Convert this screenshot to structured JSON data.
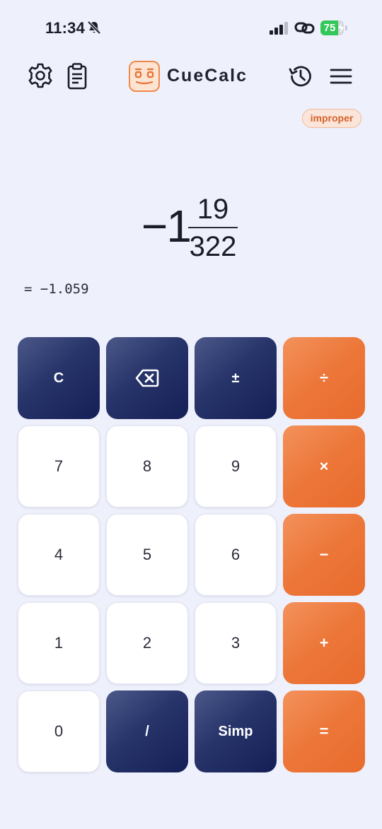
{
  "status_bar": {
    "time": "11:34",
    "battery": "75",
    "battery_level": 0.75
  },
  "header": {
    "app_title": "CueCalc",
    "icons": [
      "gear-icon",
      "clipboard-icon",
      "app-logo",
      "history-icon",
      "menu-icon"
    ]
  },
  "mode_badge": "improper",
  "display": {
    "whole": "−1",
    "numerator": "19",
    "denominator": "322",
    "decimal": "= −1.059"
  },
  "keypad": {
    "row1": [
      "C",
      "backspace",
      "±",
      "÷"
    ],
    "row2": [
      "7",
      "8",
      "9",
      "×"
    ],
    "row3": [
      "4",
      "5",
      "6",
      "−"
    ],
    "row4": [
      "1",
      "2",
      "3",
      "+"
    ],
    "row5": [
      "0",
      "/",
      "Simp",
      "="
    ]
  },
  "colors": {
    "background": "#eef0fb",
    "accent": "#ec7638",
    "dark_key": "#27346a"
  }
}
